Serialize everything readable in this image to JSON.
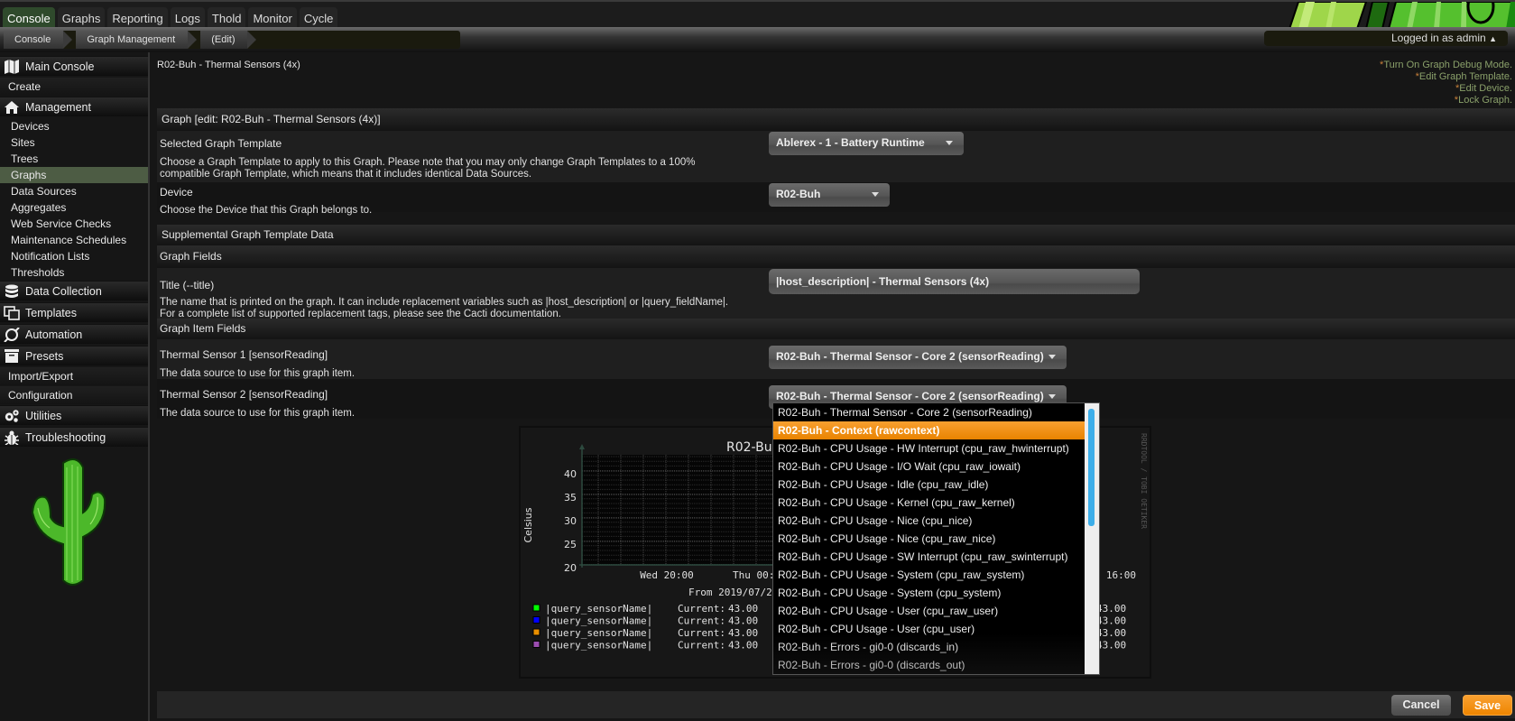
{
  "topnav": {
    "tabs": [
      {
        "label": "Console",
        "active": true
      },
      {
        "label": "Graphs"
      },
      {
        "label": "Reporting"
      },
      {
        "label": "Logs"
      },
      {
        "label": "Thold"
      },
      {
        "label": "Monitor"
      },
      {
        "label": "Cycle"
      }
    ]
  },
  "breadcrumb": [
    "Console",
    "Graph Management",
    "(Edit)"
  ],
  "user": {
    "login_text": "Logged in as admin"
  },
  "sidebar": {
    "main_console": "Main Console",
    "create": "Create",
    "management": "Management",
    "management_items": [
      "Devices",
      "Sites",
      "Trees",
      "Graphs",
      "Data Sources",
      "Aggregates",
      "Web Service Checks",
      "Maintenance Schedules",
      "Notification Lists",
      "Thresholds"
    ],
    "active_item": "Graphs",
    "data_collection": "Data Collection",
    "templates": "Templates",
    "automation": "Automation",
    "presets": "Presets",
    "import_export": "Import/Export",
    "configuration": "Configuration",
    "utilities": "Utilities",
    "troubleshooting": "Troubleshooting"
  },
  "page": {
    "title": "R02-Buh - Thermal Sensors (4x)",
    "actions": [
      "Turn On Graph Debug Mode.",
      "Edit Graph Template.",
      "Edit Device.",
      "Lock Graph."
    ],
    "graph_header": "Graph [edit: R02-Buh - Thermal Sensors (4x)]",
    "template_label": "Selected Graph Template",
    "template_desc": "Choose a Graph Template to apply to this Graph. Please note that you may only change Graph Templates to a 100% compatible Graph Template, which means that it includes identical Data Sources.",
    "template_value": "Ablerex - 1 - Battery Runtime",
    "device_label": "Device",
    "device_desc": "Choose the Device that this Graph belongs to.",
    "device_value": "R02-Buh",
    "supplemental_header": "Supplemental Graph Template Data",
    "graph_fields_header": "Graph Fields",
    "title_label": "Title (--title)",
    "title_desc_1": "The name that is printed on the graph. It can include replacement variables such as |host_description| or |query_fieldName|.",
    "title_desc_2": "For a complete list of supported replacement tags, please see the Cacti documentation.",
    "title_value": "|host_description| - Thermal Sensors (4x)",
    "graph_item_header": "Graph Item Fields",
    "sensor1_label": "Thermal Sensor 1 [sensorReading]",
    "sensor1_desc": "The data source to use for this graph item.",
    "sensor1_value": "R02-Buh - Thermal Sensor - Core 2 (sensorReading)",
    "sensor2_label": "Thermal Sensor 2 [sensorReading]",
    "sensor2_desc": "The data source to use for this graph item.",
    "sensor2_value": "R02-Buh - Thermal Sensor - Core 2 (sensorReading)"
  },
  "dropdown": {
    "highlighted_index": 1,
    "options": [
      "R02-Buh - Thermal Sensor - Core 2 (sensorReading)",
      "R02-Buh - Context (rawcontext)",
      "R02-Buh - CPU Usage - HW Interrupt (cpu_raw_hwinterrupt)",
      "R02-Buh - CPU Usage - I/O Wait (cpu_raw_iowait)",
      "R02-Buh - CPU Usage - Idle (cpu_raw_idle)",
      "R02-Buh - CPU Usage - Kernel (cpu_raw_kernel)",
      "R02-Buh - CPU Usage - Nice (cpu_nice)",
      "R02-Buh - CPU Usage - Nice (cpu_raw_nice)",
      "R02-Buh - CPU Usage - SW Interrupt (cpu_raw_swinterrupt)",
      "R02-Buh - CPU Usage - System (cpu_raw_system)",
      "R02-Buh - CPU Usage - System (cpu_system)",
      "R02-Buh - CPU Usage - User (cpu_raw_user)",
      "R02-Buh - CPU Usage - User (cpu_user)",
      "R02-Buh - Errors - gi0-0 (discards_in)",
      "R02-Buh - Errors - gi0-0 (discards_out)"
    ]
  },
  "graph_preview": {
    "title_visible": "R02-Bu",
    "ylabel": "Celsius",
    "y_ticks": [
      "40",
      "35",
      "30",
      "25",
      "20"
    ],
    "x_ticks": [
      "Wed 20:00",
      "Thu 00:",
      "hu 16:00"
    ],
    "from_text": "From 2019/07/2",
    "watermark": "RRDTOOL / TOBI OETIKER",
    "legend": [
      {
        "name": "|query_sensorName|",
        "label": "Current:",
        "value": "43.00",
        "value2": "43.00",
        "color": "#00ff00"
      },
      {
        "name": "|query_sensorName|",
        "label": "Current:",
        "value": "43.00",
        "value2": "43.00",
        "color": "#0000ff"
      },
      {
        "name": "|query_sensorName|",
        "label": "Current:",
        "value": "43.00",
        "value2": "43.00",
        "color": "#ea8f00"
      },
      {
        "name": "|query_sensorName|",
        "label": "Current:",
        "value": "43.00",
        "value2": "43.00",
        "color": "#9b4db0"
      }
    ]
  },
  "footer": {
    "cancel": "Cancel",
    "save": "Save"
  },
  "colors": {
    "accent": "#f28c00",
    "active_nav": "#4d5c44",
    "link": "#8aa06a"
  }
}
